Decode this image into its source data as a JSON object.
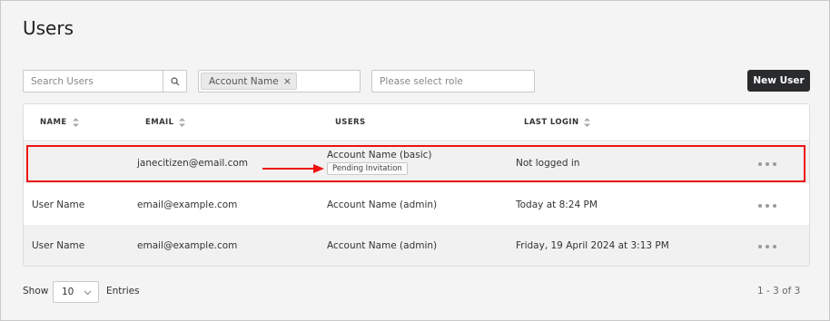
{
  "page": {
    "title": "Users"
  },
  "filters": {
    "search_placeholder": "Search Users",
    "account_chip": "Account Name",
    "account_chip_remove": "×",
    "role_placeholder": "Please select role",
    "new_user_label": "New User"
  },
  "table": {
    "headers": {
      "name": "NAME",
      "email": "EMAIL",
      "users": "USERS",
      "last_login": "LAST LOGIN"
    },
    "rows": [
      {
        "name": "",
        "email": "janecitizen@email.com",
        "users": "Account Name (basic)",
        "badge": "Pending Invitation",
        "last_login": "Not logged in"
      },
      {
        "name": "User Name",
        "email": "email@example.com",
        "users": "Account Name (admin)",
        "last_login": "Today at 8:24 PM"
      },
      {
        "name": "User Name",
        "email": "email@example.com",
        "users": "Account Name (admin)",
        "last_login": "Friday, 19 April 2024 at 3:13 PM"
      }
    ]
  },
  "footer": {
    "show_label": "Show",
    "page_size": "10",
    "entries_label": "Entries",
    "range": "1 - 3 of 3"
  },
  "colors": {
    "highlight": "#e11111",
    "primary_button": "#2a2b2d",
    "alt_row": "#f1f1f2"
  }
}
